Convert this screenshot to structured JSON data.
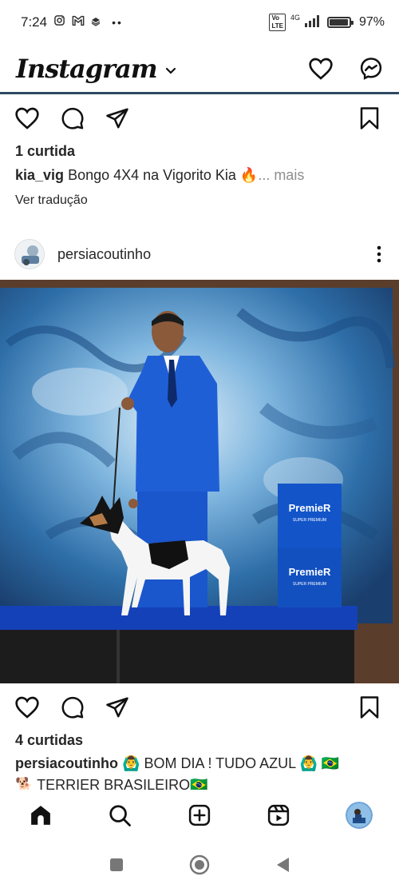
{
  "status_bar": {
    "time": "7:24",
    "network": "4G",
    "battery": "97%",
    "battery_level": 0.97
  },
  "header": {
    "logo": "Instagram",
    "icons": [
      "chevron-down-icon",
      "heart-icon",
      "messenger-icon"
    ]
  },
  "post1": {
    "likes": "1 curtida",
    "username": "kia_vig",
    "caption": "Bongo 4X4 na Vigorito Kia 🔥",
    "more": "... mais",
    "translate": "Ver tradução"
  },
  "post2": {
    "username": "persiacoutinho",
    "photo_text": {
      "box_brand": "PremieR",
      "box_sub": "SUPER PREMIUM"
    },
    "likes": "4 curtidas",
    "caption_user": "persiacoutinho",
    "caption_line1": "🙆‍♂️ BOM DIA ! TUDO AZUL 🙆‍♂️ 🇧🇷",
    "caption_line2": "🐕 TERRIER BRASILEIRO🇧🇷"
  },
  "bottom_nav": {
    "items": [
      "home-icon",
      "search-icon",
      "new-post-icon",
      "reels-icon",
      "profile-avatar"
    ]
  },
  "system_nav": {
    "items": [
      "recents-button",
      "home-button",
      "back-button"
    ]
  },
  "colors": {
    "header_rule": "#2f4a63",
    "text": "#262626",
    "muted": "#8e8e8e",
    "suit_blue": "#1f5fd6"
  }
}
